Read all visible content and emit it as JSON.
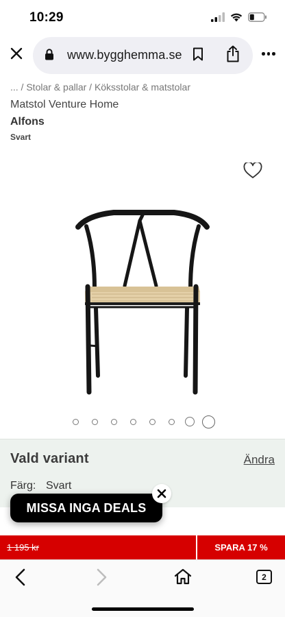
{
  "status": {
    "time": "10:29"
  },
  "browser": {
    "url": "www.bygghemma.se",
    "tab_count": "2"
  },
  "breadcrumb": "... / Stolar & pallar / Köksstolar & matstolar",
  "product": {
    "category": "Matstol Venture Home",
    "name": "Alfons",
    "variant": "Svart"
  },
  "carousel": {
    "dot_count": 8,
    "active_index": 7
  },
  "variant_panel": {
    "title": "Vald variant",
    "change_label": "Ändra",
    "color_label": "Färg:",
    "color_value": "Svart"
  },
  "deals_banner": {
    "text": "MISSA INGA DEALS"
  },
  "price": {
    "old": "1 195 kr",
    "save": "SPARA 17 %"
  },
  "colors": {
    "accent_red": "#d60000",
    "panel_bg": "#edf2ee",
    "banner_bg": "#000000"
  },
  "icons": [
    "close-icon",
    "lock-icon",
    "bookmark-icon",
    "share-icon",
    "more-icon",
    "heart-icon",
    "back-icon",
    "forward-icon",
    "home-icon",
    "tabs-icon"
  ]
}
